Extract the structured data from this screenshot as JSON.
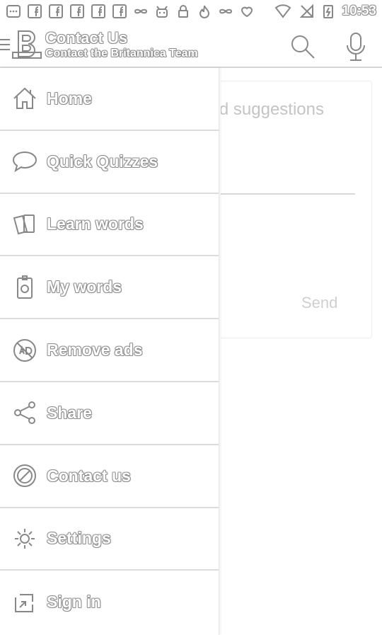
{
  "status_bar": {
    "time": "10:53",
    "left_icons": [
      "chat-bubble-icon",
      "facebook-icon",
      "facebook-icon",
      "facebook-icon",
      "facebook-icon",
      "facebook-icon",
      "infinity-icon",
      "robot-icon",
      "lock-icon",
      "fire-icon",
      "infinity-icon",
      "heart-icon"
    ],
    "right_icons": [
      "wifi-icon",
      "no-signal-icon",
      "battery-charging-icon"
    ]
  },
  "app_bar": {
    "title": "Contact Us",
    "subtitle": "Contact the Britannica Team",
    "logo_letter": "B"
  },
  "content": {
    "message_placeholder": "nd suggestions",
    "send_label": "Send"
  },
  "drawer": {
    "items": [
      {
        "label": "Home",
        "icon": "home-icon"
      },
      {
        "label": "Quick Quizzes",
        "icon": "speech-bubble-icon"
      },
      {
        "label": "Learn words",
        "icon": "cards-icon"
      },
      {
        "label": "My words",
        "icon": "badge-icon"
      },
      {
        "label": "Remove ads",
        "icon": "no-ads-icon"
      },
      {
        "label": "Share",
        "icon": "share-icon"
      },
      {
        "label": "Contact us",
        "icon": "prohibited-icon"
      },
      {
        "label": "Settings",
        "icon": "gear-icon"
      },
      {
        "label": "Sign in",
        "icon": "sign-in-icon"
      }
    ]
  }
}
